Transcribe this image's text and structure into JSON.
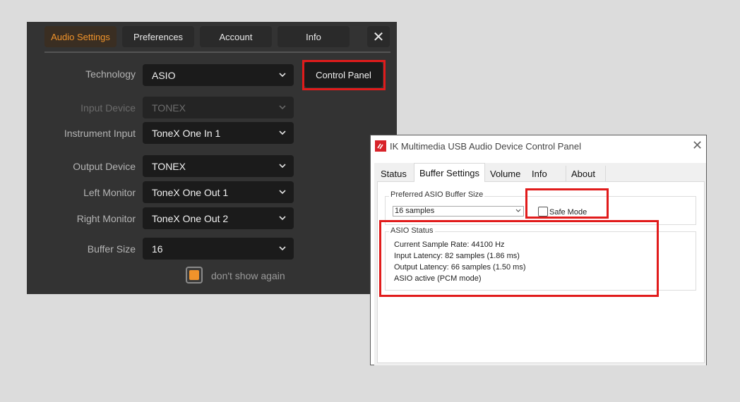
{
  "tonex": {
    "tabs": [
      "Audio Settings",
      "Preferences",
      "Account",
      "Info"
    ],
    "close_glyph": "✕",
    "technology": {
      "label": "Technology",
      "value": "ASIO"
    },
    "control_panel_button": "Control Panel",
    "input_device": {
      "label": "Input Device",
      "value": "TONEX"
    },
    "instrument_input": {
      "label": "Instrument Input",
      "value": "ToneX One In 1"
    },
    "output_device": {
      "label": "Output Device",
      "value": "TONEX"
    },
    "left_monitor": {
      "label": "Left Monitor",
      "value": "ToneX One Out 1"
    },
    "right_monitor": {
      "label": "Right Monitor",
      "value": "ToneX One Out 2"
    },
    "buffer_size": {
      "label": "Buffer Size",
      "value": "16"
    },
    "dont_show_again": "don't show again",
    "colors": {
      "accent": "#f0932b",
      "highlight": "#e11b1b"
    }
  },
  "ikpanel": {
    "title": "IK Multimedia USB Audio Device Control Panel",
    "tabs": [
      "Status",
      "Buffer Settings",
      "Volume",
      "Info",
      "About"
    ],
    "buffer_group_label": "Preferred ASIO Buffer Size",
    "buffer_value": "16 samples",
    "safe_mode_label": "Safe Mode",
    "status_group_label": "ASIO Status",
    "status_lines": [
      "Current Sample Rate: 44100 Hz",
      "Input Latency: 82 samples (1.86 ms)",
      "Output Latency: 66 samples (1.50 ms)",
      "ASIO active (PCM mode)"
    ],
    "close_glyph": "✕",
    "colors": {
      "logo": "#d8232a"
    }
  }
}
